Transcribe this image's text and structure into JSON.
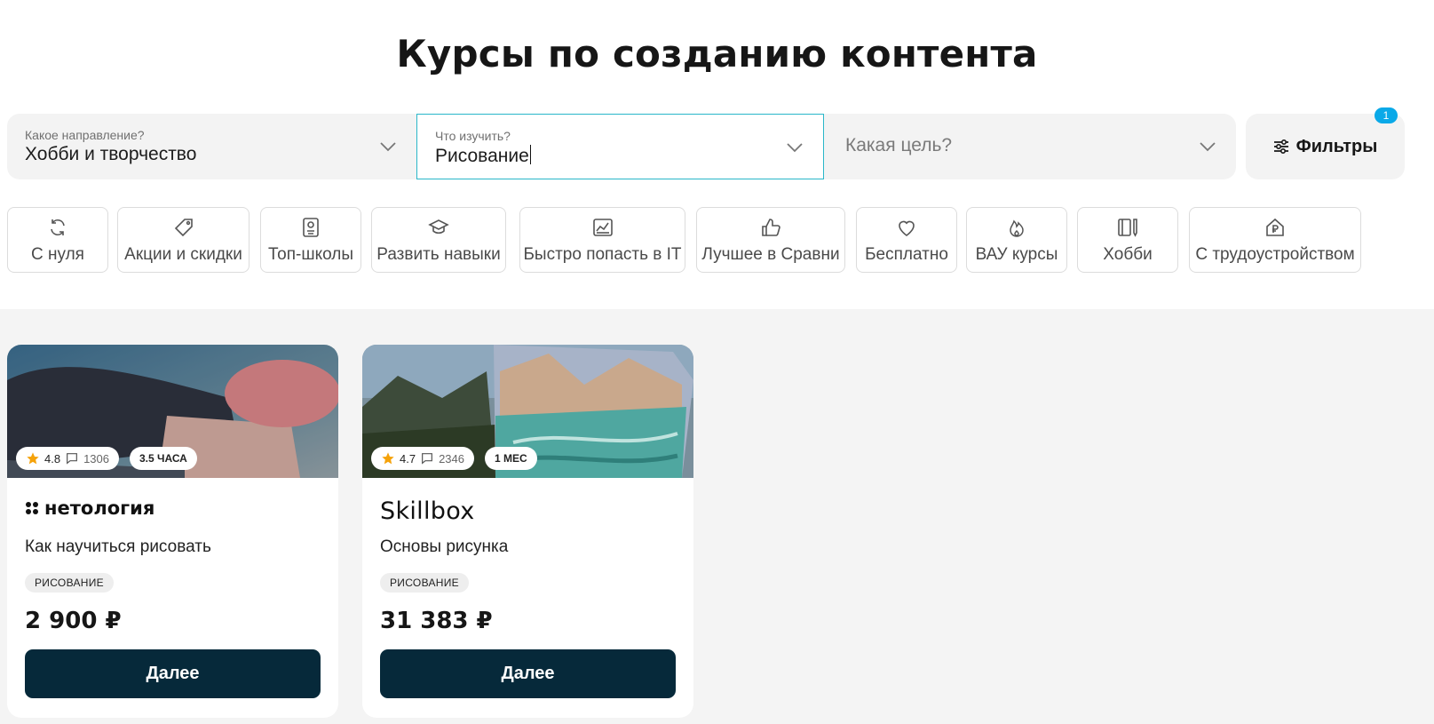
{
  "page": {
    "title": "Курсы по созданию контента"
  },
  "search": {
    "direction": {
      "label": "Какое направление?",
      "value": "Хобби и творчество"
    },
    "subject": {
      "label": "Что изучить?",
      "value": "Рисование"
    },
    "goal": {
      "placeholder": "Какая цель?"
    },
    "filters": {
      "label": "Фильтры",
      "badge": "1"
    }
  },
  "chips": [
    {
      "label": "С нуля",
      "icon": "refresh-icon"
    },
    {
      "label": "Акции и скидки",
      "icon": "tag-icon"
    },
    {
      "label": "Топ-школы",
      "icon": "certificate-icon"
    },
    {
      "label": "Развить навыки",
      "icon": "graduation-cap-icon"
    },
    {
      "label": "Быстро попасть в IT",
      "icon": "chart-icon"
    },
    {
      "label": "Лучшее в Сравни",
      "icon": "thumbs-up-icon"
    },
    {
      "label": "Бесплатно",
      "icon": "heart-icon"
    },
    {
      "label": "ВАУ курсы",
      "icon": "fire-icon"
    },
    {
      "label": "Хобби",
      "icon": "book-pen-icon"
    },
    {
      "label": "С трудоустройством",
      "icon": "house-ruble-icon"
    }
  ],
  "courses": [
    {
      "rating": "4.8",
      "reviews": "1306",
      "duration": "3.5 ЧАСА",
      "school": "нетология",
      "name": "Как научиться рисовать",
      "tag": "РИСОВАНИЕ",
      "price": "2 900 ₽",
      "button": "Далее"
    },
    {
      "rating": "4.7",
      "reviews": "2346",
      "duration": "1 МЕС",
      "school": "Skillbox",
      "name": "Основы рисунка",
      "tag": "РИСОВАНИЕ",
      "price": "31 383 ₽",
      "button": "Далее"
    }
  ],
  "colors": {
    "accent_border": "#2ab7c9",
    "button_bg": "#06293a",
    "badge_bg": "#0aa9e8",
    "star": "#f5a20a"
  }
}
